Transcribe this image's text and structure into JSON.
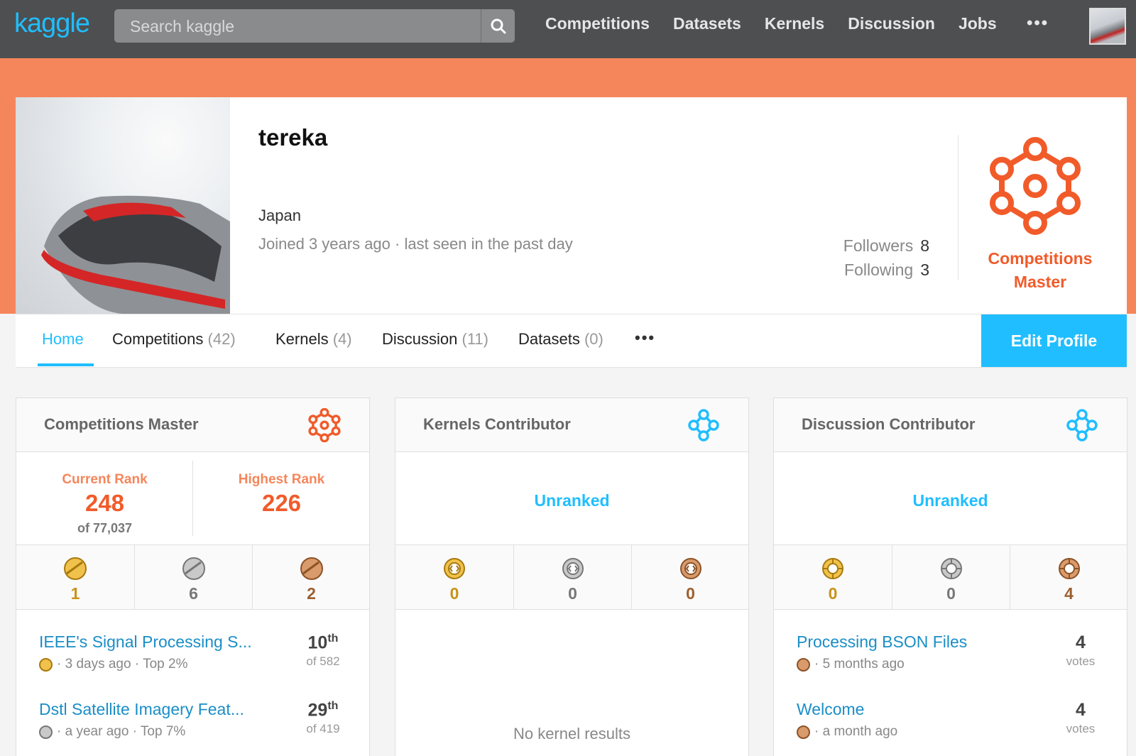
{
  "nav": {
    "logo": "kaggle",
    "search_placeholder": "Search kaggle",
    "links": [
      "Competitions",
      "Datasets",
      "Kernels",
      "Discussion",
      "Jobs"
    ],
    "more": "•••"
  },
  "profile": {
    "username": "tereka",
    "country": "Japan",
    "joined": "Joined 3 years ago · last seen in the past day",
    "followers_label": "Followers",
    "followers_count": "8",
    "following_label": "Following",
    "following_count": "3",
    "tier_line1": "Competitions",
    "tier_line2": "Master",
    "accent_color": "#f15b2a"
  },
  "tabs": {
    "home": "Home",
    "competitions": "Competitions",
    "competitions_count": "(42)",
    "kernels": "Kernels",
    "kernels_count": "(4)",
    "discussion": "Discussion",
    "discussion_count": "(11)",
    "datasets": "Datasets",
    "datasets_count": "(0)",
    "more": "•••",
    "edit_profile": "Edit Profile"
  },
  "cards": {
    "competitions": {
      "title": "Competitions Master",
      "current_rank_label": "Current Rank",
      "current_rank": "248",
      "current_rank_of": "of 77,037",
      "highest_rank_label": "Highest Rank",
      "highest_rank": "226",
      "medals": [
        "1",
        "6",
        "2"
      ],
      "items": [
        {
          "title": "IEEE's Signal Processing S...",
          "sub": "· 3 days ago · Top 2%",
          "rank": "10",
          "suffix": "th",
          "of": "of 582"
        },
        {
          "title": "Dstl Satellite Imagery Feat...",
          "sub": "· a year ago · Top 7%",
          "rank": "29",
          "suffix": "th",
          "of": "of 419"
        }
      ]
    },
    "kernels": {
      "title": "Kernels Contributor",
      "unranked": "Unranked",
      "medals": [
        "0",
        "0",
        "0"
      ],
      "empty": "No kernel results"
    },
    "discussion": {
      "title": "Discussion Contributor",
      "unranked": "Unranked",
      "medals": [
        "0",
        "0",
        "4"
      ],
      "items": [
        {
          "title": "Processing BSON Files",
          "sub": "· 5 months ago",
          "votes": "4",
          "votes_label": "votes"
        },
        {
          "title": "Welcome",
          "sub": "· a month ago",
          "votes": "4",
          "votes_label": "votes"
        }
      ]
    }
  }
}
